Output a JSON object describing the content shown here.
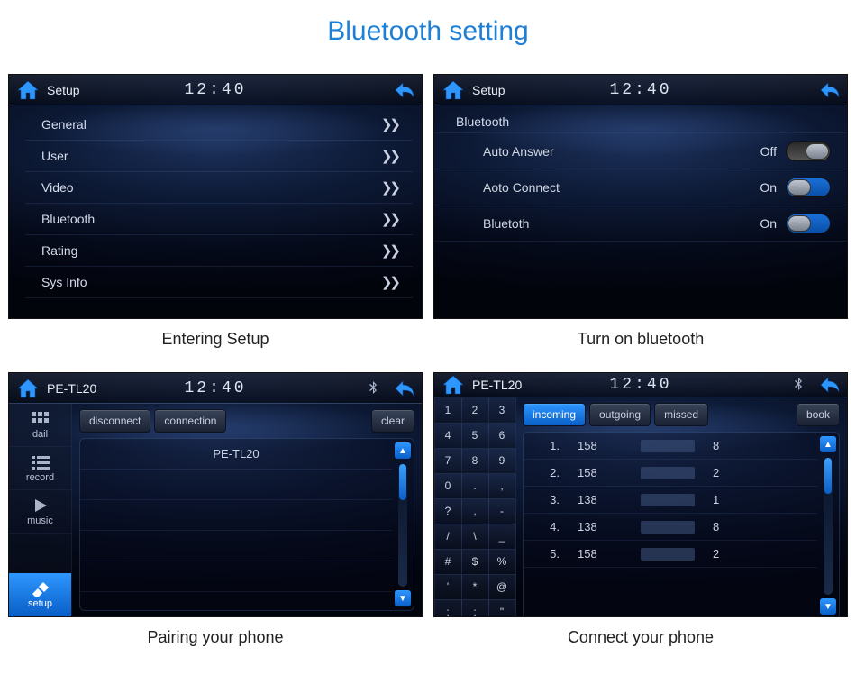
{
  "page_title": "Bluetooth setting",
  "captions": {
    "s1": "Entering Setup",
    "s2": "Turn on bluetooth",
    "s3": "Pairing your phone",
    "s4": "Connect your phone"
  },
  "clock": "12:40",
  "screen1": {
    "title": "Setup",
    "items": [
      "General",
      "User",
      "Video",
      "Bluetooth",
      "Rating",
      "Sys Info"
    ]
  },
  "screen2": {
    "title": "Setup",
    "section": "Bluetooth",
    "rows": [
      {
        "label": "Auto Answer",
        "state": "Off",
        "on": false
      },
      {
        "label": "Aoto Connect",
        "state": "On",
        "on": true
      },
      {
        "label": "Bluetoth",
        "state": "On",
        "on": true
      }
    ]
  },
  "screen3": {
    "title": "PE-TL20",
    "sidebar": [
      {
        "label": "dail",
        "icon": "dial"
      },
      {
        "label": "record",
        "icon": "list"
      },
      {
        "label": "music",
        "icon": "play"
      },
      {
        "label": "setup",
        "icon": "plug",
        "active": true
      }
    ],
    "buttons": {
      "disconnect": "disconnect",
      "connection": "connection",
      "clear": "clear"
    },
    "device": "PE-TL20"
  },
  "screen4": {
    "title": "PE-TL20",
    "keypad": [
      "1",
      "2",
      "3",
      "4",
      "5",
      "6",
      "7",
      "8",
      "9",
      "0",
      ".",
      ",",
      "?",
      ",",
      "-",
      "/",
      "\\",
      "_",
      "#",
      "$",
      "%",
      "'",
      "*",
      "@",
      ";",
      ":",
      "\""
    ],
    "tabs": {
      "incoming": "incoming",
      "outgoing": "outgoing",
      "missed": "missed",
      "book": "book"
    },
    "calls": [
      {
        "idx": "1.",
        "prefix": "158",
        "suffix": "8"
      },
      {
        "idx": "2.",
        "prefix": "158",
        "suffix": "2"
      },
      {
        "idx": "3.",
        "prefix": "138",
        "suffix": "1"
      },
      {
        "idx": "4.",
        "prefix": "138",
        "suffix": "8"
      },
      {
        "idx": "5.",
        "prefix": "158",
        "suffix": "2"
      }
    ]
  }
}
